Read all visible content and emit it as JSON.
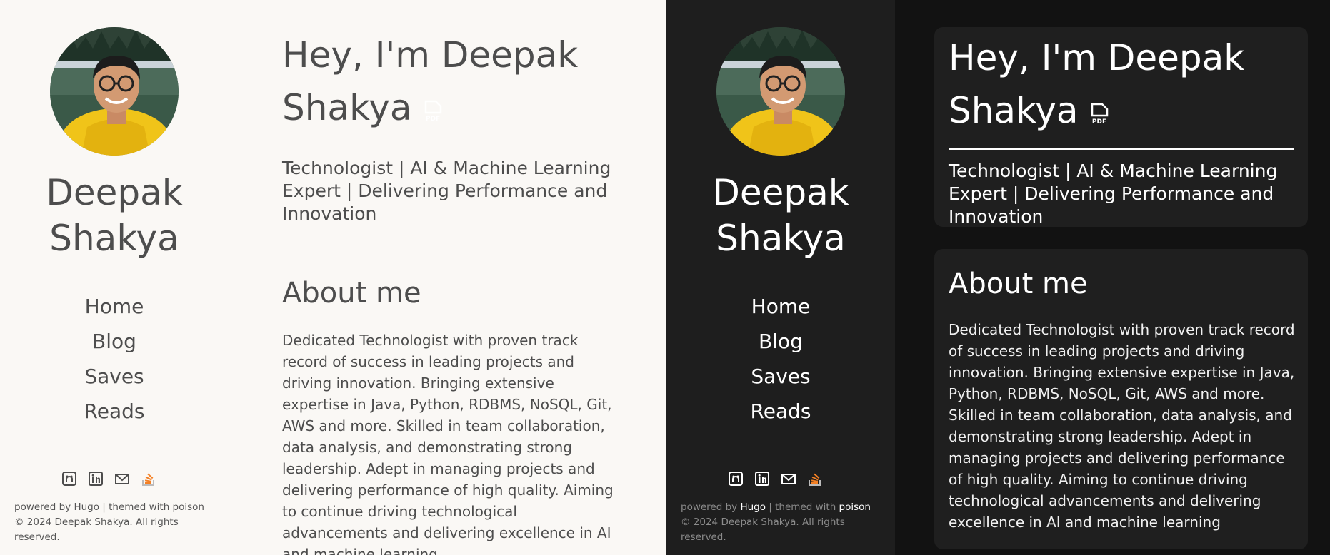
{
  "profile": {
    "name": "Deepak Shakya",
    "avatar_alt": "Profile photo"
  },
  "nav": [
    {
      "label": "Home"
    },
    {
      "label": "Blog"
    },
    {
      "label": "Saves"
    },
    {
      "label": "Reads"
    }
  ],
  "socials": [
    {
      "icon": "github-icon"
    },
    {
      "icon": "linkedin-icon"
    },
    {
      "icon": "email-icon"
    },
    {
      "icon": "stackoverflow-icon"
    }
  ],
  "footer": {
    "powered_prefix": "powered by",
    "hugo": "Hugo",
    "separator": "| themed with",
    "theme": "poison",
    "copyright": "© 2024 Deepak Shakya. All rights reserved."
  },
  "hero": {
    "title": "Hey, I'm Deepak Shakya",
    "pdf_label": "PDF",
    "tagline": "Technologist | AI & Machine Learning Expert | Delivering Performance and Innovation"
  },
  "about": {
    "heading": "About me",
    "text": "Dedicated Technologist with proven track record of success in leading projects and driving innovation. Bringing extensive expertise in Java, Python, RDBMS, NoSQL, Git, AWS and more. Skilled in team collaboration, data analysis, and demonstrating strong leadership. Adept in managing projects and delivering performance of high quality. Aiming to continue driving technological advancements and delivering excellence in AI and machine learning"
  },
  "colors": {
    "light_bg": "#faf8f5",
    "dark_bg": "#121212",
    "dark_sidebar": "#1e1e1e",
    "dark_card": "#1f1f1f",
    "stackoverflow": "#f48024"
  }
}
